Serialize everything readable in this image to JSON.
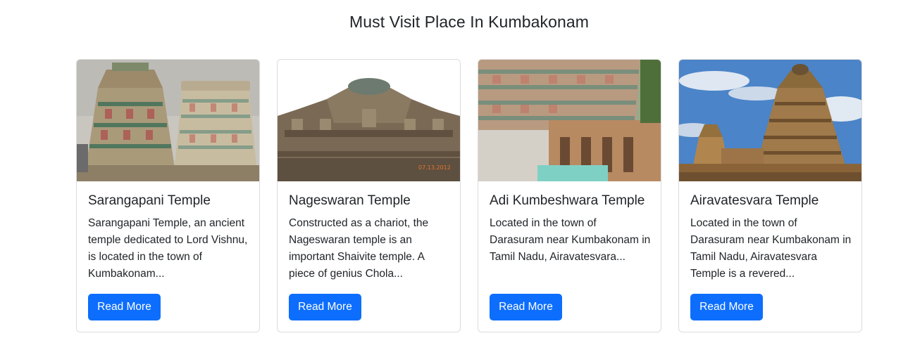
{
  "page": {
    "title": "Must Visit Place In Kumbakonam"
  },
  "cards": [
    {
      "title": "Sarangapani Temple",
      "text": "Sarangapani Temple, an ancient temple dedicated to Lord Vishnu, is located in the town of Kumbakonam...",
      "button_label": "Read More",
      "image_alt": "Sarangapani Temple gopurams"
    },
    {
      "title": "Nageswaran Temple",
      "text": "Constructed as a chariot, the Nageswaran temple is an important Shaivite temple. A piece of genius Chola...",
      "button_label": "Read More",
      "image_alt": "Nageswaran Temple carved stone",
      "image_stamp": "07.13.2012"
    },
    {
      "title": "Adi Kumbeshwara Temple",
      "text": "Located in the town of Darasuram near Kumbakonam in Tamil Nadu, Airavatesvara...",
      "button_label": "Read More",
      "image_alt": "Adi Kumbeshwara Temple gopuram"
    },
    {
      "title": "Airavatesvara Temple",
      "text": "Located in the town of Darasuram near Kumbakonam in Tamil Nadu, Airavatesvara Temple is a revered...",
      "button_label": "Read More",
      "image_alt": "Airavatesvara Temple vimana"
    }
  ],
  "colors": {
    "primary": "#0d6efd",
    "text": "#212529",
    "border": "#dcdcdc"
  }
}
